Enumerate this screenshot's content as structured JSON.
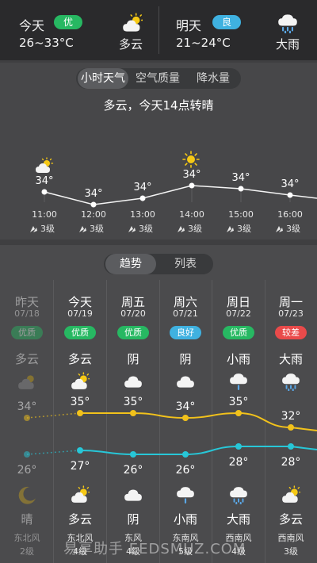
{
  "top": {
    "today": {
      "label": "今天",
      "aqi": "优",
      "aqi_color": "#27b862",
      "temp": "26~33°C",
      "condition": "多云"
    },
    "tomorrow": {
      "label": "明天",
      "aqi": "良",
      "aqi_color": "#3fb1e0",
      "temp": "21~24°C",
      "condition": "大雨"
    }
  },
  "hourly": {
    "tabs": [
      "小时天气",
      "空气质量",
      "降水量"
    ],
    "summary": "多云，今天14点转晴",
    "times": [
      "11:00",
      "12:00",
      "13:00",
      "14:00",
      "15:00",
      "16:00"
    ],
    "temps": [
      "34°",
      "34°",
      "34°",
      "34°",
      "34°",
      "34°"
    ],
    "temp_values": [
      34,
      33.6,
      33.8,
      34.2,
      34.1,
      33.9
    ],
    "winds": [
      "3级",
      "3级",
      "3级",
      "3级",
      "3级",
      "3级"
    ],
    "icons": [
      "partly-cloudy-icon",
      "",
      "",
      "sun-icon",
      "",
      ""
    ]
  },
  "trend": {
    "tabs": [
      "趋势",
      "列表"
    ],
    "days": [
      {
        "week": "昨天",
        "date": "07/18",
        "aqi": "优质",
        "aqi_color": "#27b862",
        "day_cond": "多云",
        "day_icon": "partly-cloudy-icon",
        "high": "34°",
        "low": "26°",
        "night_icon": "moon-icon",
        "night_cond": "晴",
        "wind_dir": "东北风",
        "wind_lvl": "2级",
        "dim": true
      },
      {
        "week": "今天",
        "date": "07/19",
        "aqi": "优质",
        "aqi_color": "#27b862",
        "day_cond": "多云",
        "day_icon": "partly-cloudy-icon",
        "high": "35°",
        "low": "27°",
        "night_icon": "partly-cloudy-icon",
        "night_cond": "多云",
        "wind_dir": "东北风",
        "wind_lvl": "4级",
        "dim": false
      },
      {
        "week": "周五",
        "date": "07/20",
        "aqi": "优质",
        "aqi_color": "#27b862",
        "day_cond": "阴",
        "day_icon": "cloud-icon",
        "high": "35°",
        "low": "26°",
        "night_icon": "cloud-icon",
        "night_cond": "阴",
        "wind_dir": "东风",
        "wind_lvl": "4级",
        "dim": false
      },
      {
        "week": "周六",
        "date": "07/21",
        "aqi": "良好",
        "aqi_color": "#3fb1e0",
        "day_cond": "阴",
        "day_icon": "cloud-icon",
        "high": "34°",
        "low": "26°",
        "night_icon": "light-rain-icon",
        "night_cond": "小雨",
        "wind_dir": "东南风",
        "wind_lvl": "5级",
        "dim": false
      },
      {
        "week": "周日",
        "date": "07/22",
        "aqi": "优质",
        "aqi_color": "#27b862",
        "day_cond": "小雨",
        "day_icon": "light-rain-icon",
        "high": "35°",
        "low": "28°",
        "night_icon": "heavy-rain-icon",
        "night_cond": "大雨",
        "wind_dir": "西南风",
        "wind_lvl": "4级",
        "dim": false
      },
      {
        "week": "周一",
        "date": "07/23",
        "aqi": "较差",
        "aqi_color": "#e94a4a",
        "day_cond": "大雨",
        "day_icon": "heavy-rain-icon",
        "high": "32°",
        "low": "28°",
        "night_icon": "partly-cloudy-icon",
        "night_cond": "多云",
        "wind_dir": "西南风",
        "wind_lvl": "3级",
        "dim": false
      }
    ],
    "high_values": [
      34,
      35,
      35,
      34,
      35,
      32
    ],
    "low_values": [
      26,
      27,
      26,
      26,
      28,
      28
    ],
    "high_color": "#f2c21b",
    "low_color": "#27c7d8"
  },
  "watermark": "易享助手 EEDSMUZ.COM"
}
